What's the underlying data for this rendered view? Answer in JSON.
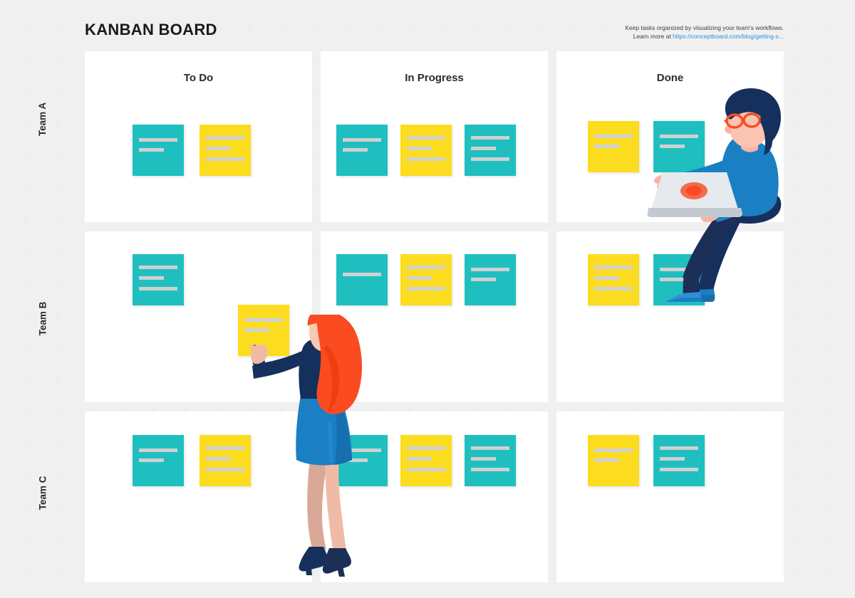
{
  "header": {
    "title": "KANBAN BOARD",
    "note_line1": "Keep tasks organized by visualizing your team's workflows.",
    "note_line2_prefix": "Learn more at ",
    "note_link": "https://conceptboard.com/blog/getting-s...",
    "link_color": "#2f8fd8"
  },
  "board": {
    "columns": [
      {
        "id": "todo",
        "label": "To Do"
      },
      {
        "id": "in-progress",
        "label": "In Progress"
      },
      {
        "id": "done",
        "label": "Done"
      }
    ],
    "rows": [
      {
        "id": "team-a",
        "label": "Team A"
      },
      {
        "id": "team-b",
        "label": "Team B"
      },
      {
        "id": "team-c",
        "label": "Team C"
      }
    ],
    "cells": {
      "team-a": {
        "todo": [
          {
            "color": "teal",
            "lines": 2
          },
          {
            "color": "yellow",
            "lines": 3
          }
        ],
        "in-progress": [
          {
            "color": "teal",
            "lines": 2
          },
          {
            "color": "yellow",
            "lines": 3
          },
          {
            "color": "teal",
            "lines": 3
          }
        ],
        "done": [
          {
            "color": "yellow",
            "lines": 2
          },
          {
            "color": "teal",
            "lines": 2
          }
        ]
      },
      "team-b": {
        "todo": [
          {
            "color": "teal",
            "lines": 3
          }
        ],
        "in-progress": [
          {
            "color": "teal",
            "lines": 1
          },
          {
            "color": "yellow",
            "lines": 3
          },
          {
            "color": "teal",
            "lines": 2
          }
        ],
        "done": [
          {
            "color": "yellow",
            "lines": 3
          },
          {
            "color": "teal",
            "lines": 2
          }
        ]
      },
      "team-c": {
        "todo": [
          {
            "color": "teal",
            "lines": 2
          },
          {
            "color": "yellow",
            "lines": 3
          }
        ],
        "in-progress": [
          {
            "color": "teal",
            "lines": 2
          },
          {
            "color": "yellow",
            "lines": 3
          },
          {
            "color": "teal",
            "lines": 3
          }
        ],
        "done": [
          {
            "color": "yellow",
            "lines": 2
          },
          {
            "color": "teal",
            "lines": 3
          }
        ]
      }
    },
    "floating_note": {
      "color": "yellow",
      "lines": 2
    }
  },
  "colors": {
    "background": "#f0f0f0",
    "card": "#ffffff",
    "sticky_teal": "#1fbfbf",
    "sticky_yellow": "#fcdc1e",
    "sticky_line": "#cfd0d1",
    "text": "#2b2b2b"
  },
  "illustrations": [
    {
      "id": "man-with-laptop",
      "description": "Man with glasses sitting on board edge holding a laptop"
    },
    {
      "id": "woman-placing-note",
      "description": "Woman with orange hair placing a yellow sticky note"
    }
  ]
}
